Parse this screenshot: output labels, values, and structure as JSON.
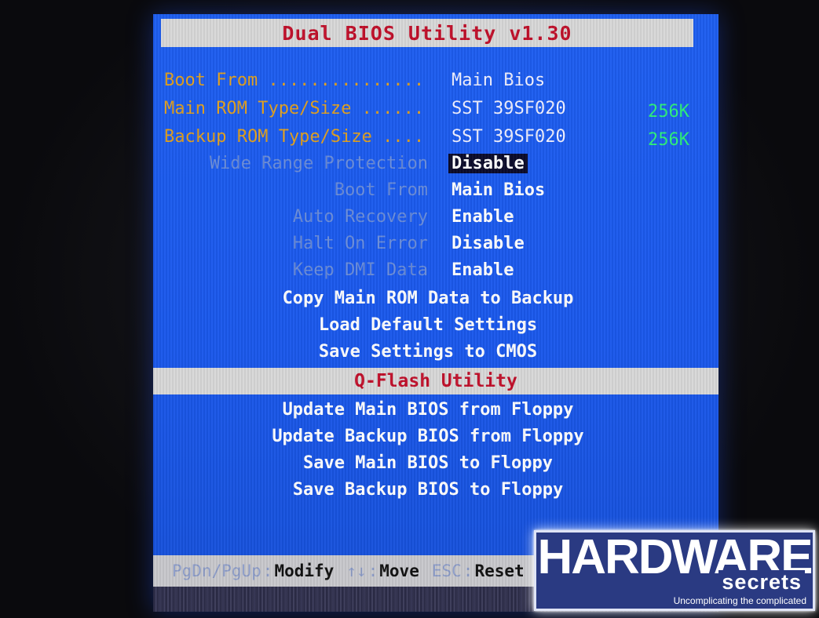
{
  "title": "Dual BIOS Utility v1.30",
  "info": [
    {
      "label": "Boot From ...............",
      "value": "Main Bios",
      "size": ""
    },
    {
      "label": "Main ROM Type/Size ......",
      "value": "SST 39SF020",
      "size": "256K"
    },
    {
      "label": "Backup ROM Type/Size ....",
      "value": "SST 39SF020",
      "size": "256K"
    }
  ],
  "options": [
    {
      "label": "Wide Range Protection",
      "value": "Disable"
    },
    {
      "label": "Boot From",
      "value": "Main Bios"
    },
    {
      "label": "Auto Recovery",
      "value": "Enable"
    },
    {
      "label": "Halt On Error",
      "value": "Disable"
    },
    {
      "label": "Keep DMI Data",
      "value": "Enable"
    }
  ],
  "actions": [
    "Copy Main ROM Data to Backup",
    "Load Default Settings",
    "Save Settings to CMOS"
  ],
  "section_title": "Q-Flash Utility",
  "qflash_actions": [
    "Update Main BIOS from Floppy",
    "Update Backup BIOS from Floppy",
    "Save Main BIOS to Floppy",
    "Save Backup BIOS to Floppy"
  ],
  "footer": {
    "key1": "PgDn/PgUp",
    "action1": "Modify",
    "key2": "↑↓",
    "action2": "Move",
    "key3": "ESC",
    "action3": "Reset"
  },
  "logo": {
    "main": "HARDWARE",
    "sub": "secrets",
    "tagline": "Uncomplicating the complicated"
  },
  "colors": {
    "screen_blue": "#1a58ec",
    "title_red": "#c0102a",
    "info_amber": "#e0a020",
    "size_green": "#2cf07a"
  }
}
